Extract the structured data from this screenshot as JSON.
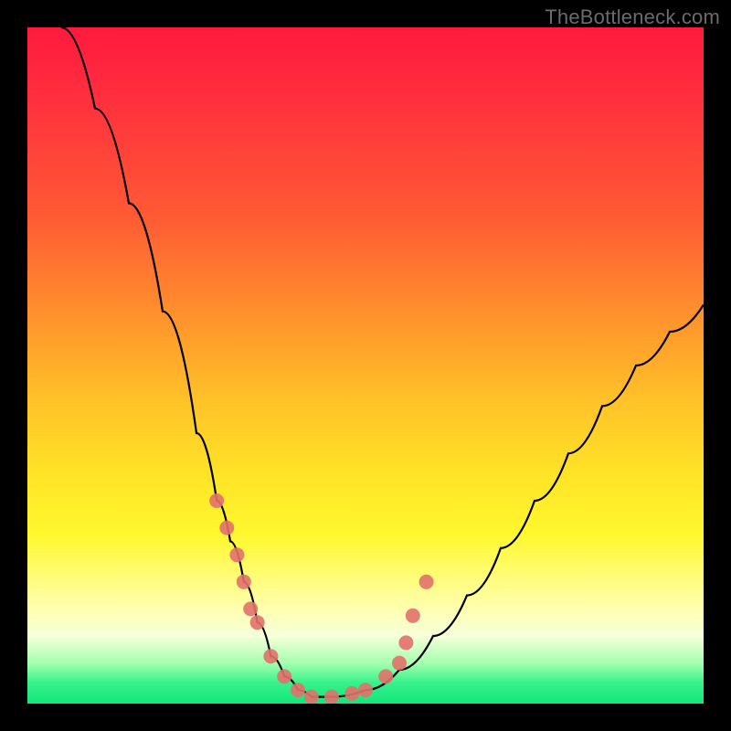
{
  "watermark": "TheBottleneck.com",
  "chart_data": {
    "type": "line",
    "title": "",
    "xlabel": "",
    "ylabel": "",
    "xlim": [
      0,
      100
    ],
    "ylim": [
      0,
      100
    ],
    "grid": false,
    "legend": false,
    "series": [
      {
        "name": "bottleneck-curve",
        "color": "#000000",
        "x": [
          5,
          10,
          15,
          20,
          25,
          28,
          30,
          32,
          34,
          36,
          38,
          40,
          42,
          45,
          50,
          55,
          60,
          65,
          70,
          75,
          80,
          85,
          90,
          95,
          100
        ],
        "y": [
          100,
          88,
          74,
          58,
          40,
          30,
          24,
          18,
          12,
          7,
          4,
          2,
          1,
          1,
          2,
          5,
          10,
          16,
          23,
          30,
          37,
          44,
          50,
          55,
          59
        ]
      }
    ],
    "markers": [
      {
        "name": "data-points",
        "color": "#e2716b",
        "shape": "circle",
        "x": [
          28,
          29.5,
          31,
          32,
          33,
          34,
          36,
          38,
          40,
          42,
          45,
          48,
          50,
          53,
          55,
          56,
          57,
          59
        ],
        "y": [
          30,
          26,
          22,
          18,
          14,
          12,
          7,
          4,
          2,
          1,
          1,
          1.5,
          2,
          4,
          6,
          9,
          13,
          18
        ]
      }
    ],
    "background_gradient": {
      "orientation": "vertical",
      "stops": [
        {
          "pos": 0,
          "color": "#ff1a3e"
        },
        {
          "pos": 28,
          "color": "#ff5a34"
        },
        {
          "pos": 55,
          "color": "#ffc128"
        },
        {
          "pos": 75,
          "color": "#fff82d"
        },
        {
          "pos": 90,
          "color": "#f6ffd9"
        },
        {
          "pos": 100,
          "color": "#12e77a"
        }
      ]
    }
  }
}
